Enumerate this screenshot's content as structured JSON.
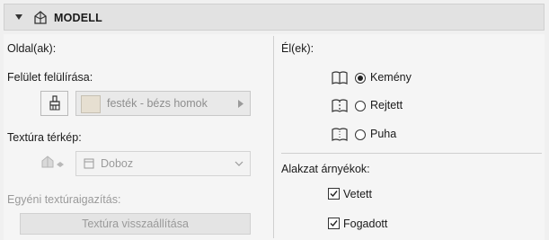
{
  "header": {
    "title": "MODELL"
  },
  "left": {
    "sides_label": "Oldal(ak):",
    "surface_override_label": "Felület felülírása:",
    "surface_value": "festék - bézs homok",
    "texture_map_label": "Textúra térkép:",
    "texture_value": "Doboz",
    "custom_alignment_label": "Egyéni textúraigazítás:",
    "reset_button_label": "Textúra visszaállítása"
  },
  "right": {
    "edges_label": "Él(ek):",
    "edges": [
      {
        "label": "Kemény",
        "selected": true
      },
      {
        "label": "Rejtett",
        "selected": false
      },
      {
        "label": "Puha",
        "selected": false
      }
    ],
    "shadows_label": "Alakzat árnyékok:",
    "shadows": [
      {
        "label": "Vetett",
        "checked": true
      },
      {
        "label": "Fogadott",
        "checked": true
      }
    ]
  },
  "colors": {
    "header_bg": "#e2e2e2",
    "swatch": "#e6dfd1",
    "panel_bg": "#f5f5f5"
  }
}
